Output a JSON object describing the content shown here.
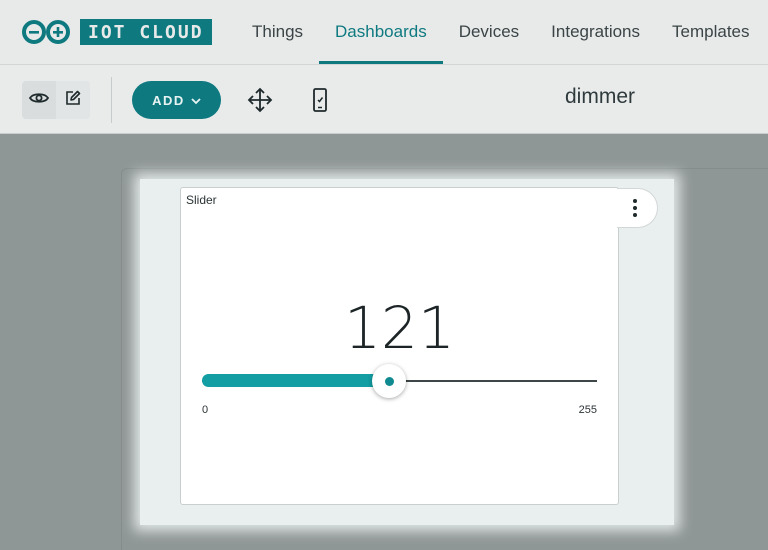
{
  "nav": {
    "logo_text": "IOT CLOUD",
    "tabs": [
      {
        "label": "Things",
        "active": false
      },
      {
        "label": "Dashboards",
        "active": true
      },
      {
        "label": "Devices",
        "active": false
      },
      {
        "label": "Integrations",
        "active": false
      },
      {
        "label": "Templates",
        "active": false
      }
    ]
  },
  "toolbar": {
    "add_label": "ADD",
    "dashboard_title": "dimmer"
  },
  "widget": {
    "title": "Slider",
    "value": "121",
    "min_label": "0",
    "max_label": "255",
    "min": 0,
    "max": 255,
    "current": 121
  },
  "colors": {
    "accent": "#0e7a80",
    "slider_fill": "#129ea3"
  }
}
